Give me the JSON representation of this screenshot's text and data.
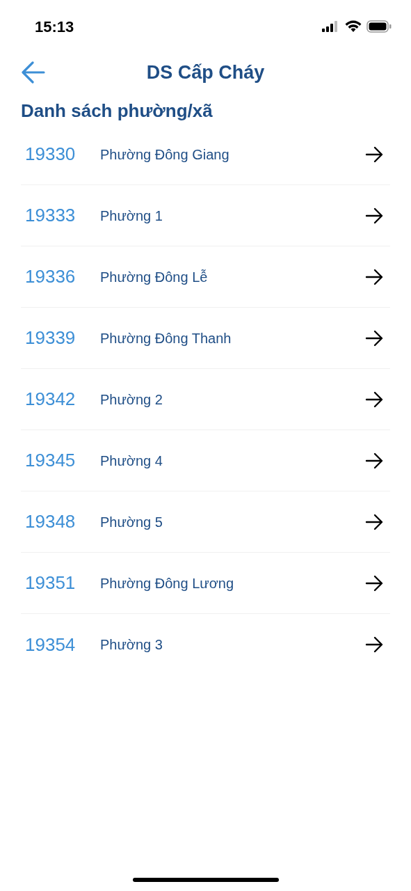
{
  "status_bar": {
    "time": "15:13"
  },
  "nav": {
    "title": "DS Cấp Cháy"
  },
  "section": {
    "title": "Danh sách phường/xã"
  },
  "rows": [
    {
      "code": "19330",
      "name": "Phường Đông Giang"
    },
    {
      "code": "19333",
      "name": "Phường 1"
    },
    {
      "code": "19336",
      "name": "Phường Đông Lễ"
    },
    {
      "code": "19339",
      "name": "Phường Đông Thanh"
    },
    {
      "code": "19342",
      "name": "Phường 2"
    },
    {
      "code": "19345",
      "name": "Phường 4"
    },
    {
      "code": "19348",
      "name": "Phường 5"
    },
    {
      "code": "19351",
      "name": "Phường Đông Lương"
    },
    {
      "code": "19354",
      "name": "Phường 3"
    }
  ]
}
